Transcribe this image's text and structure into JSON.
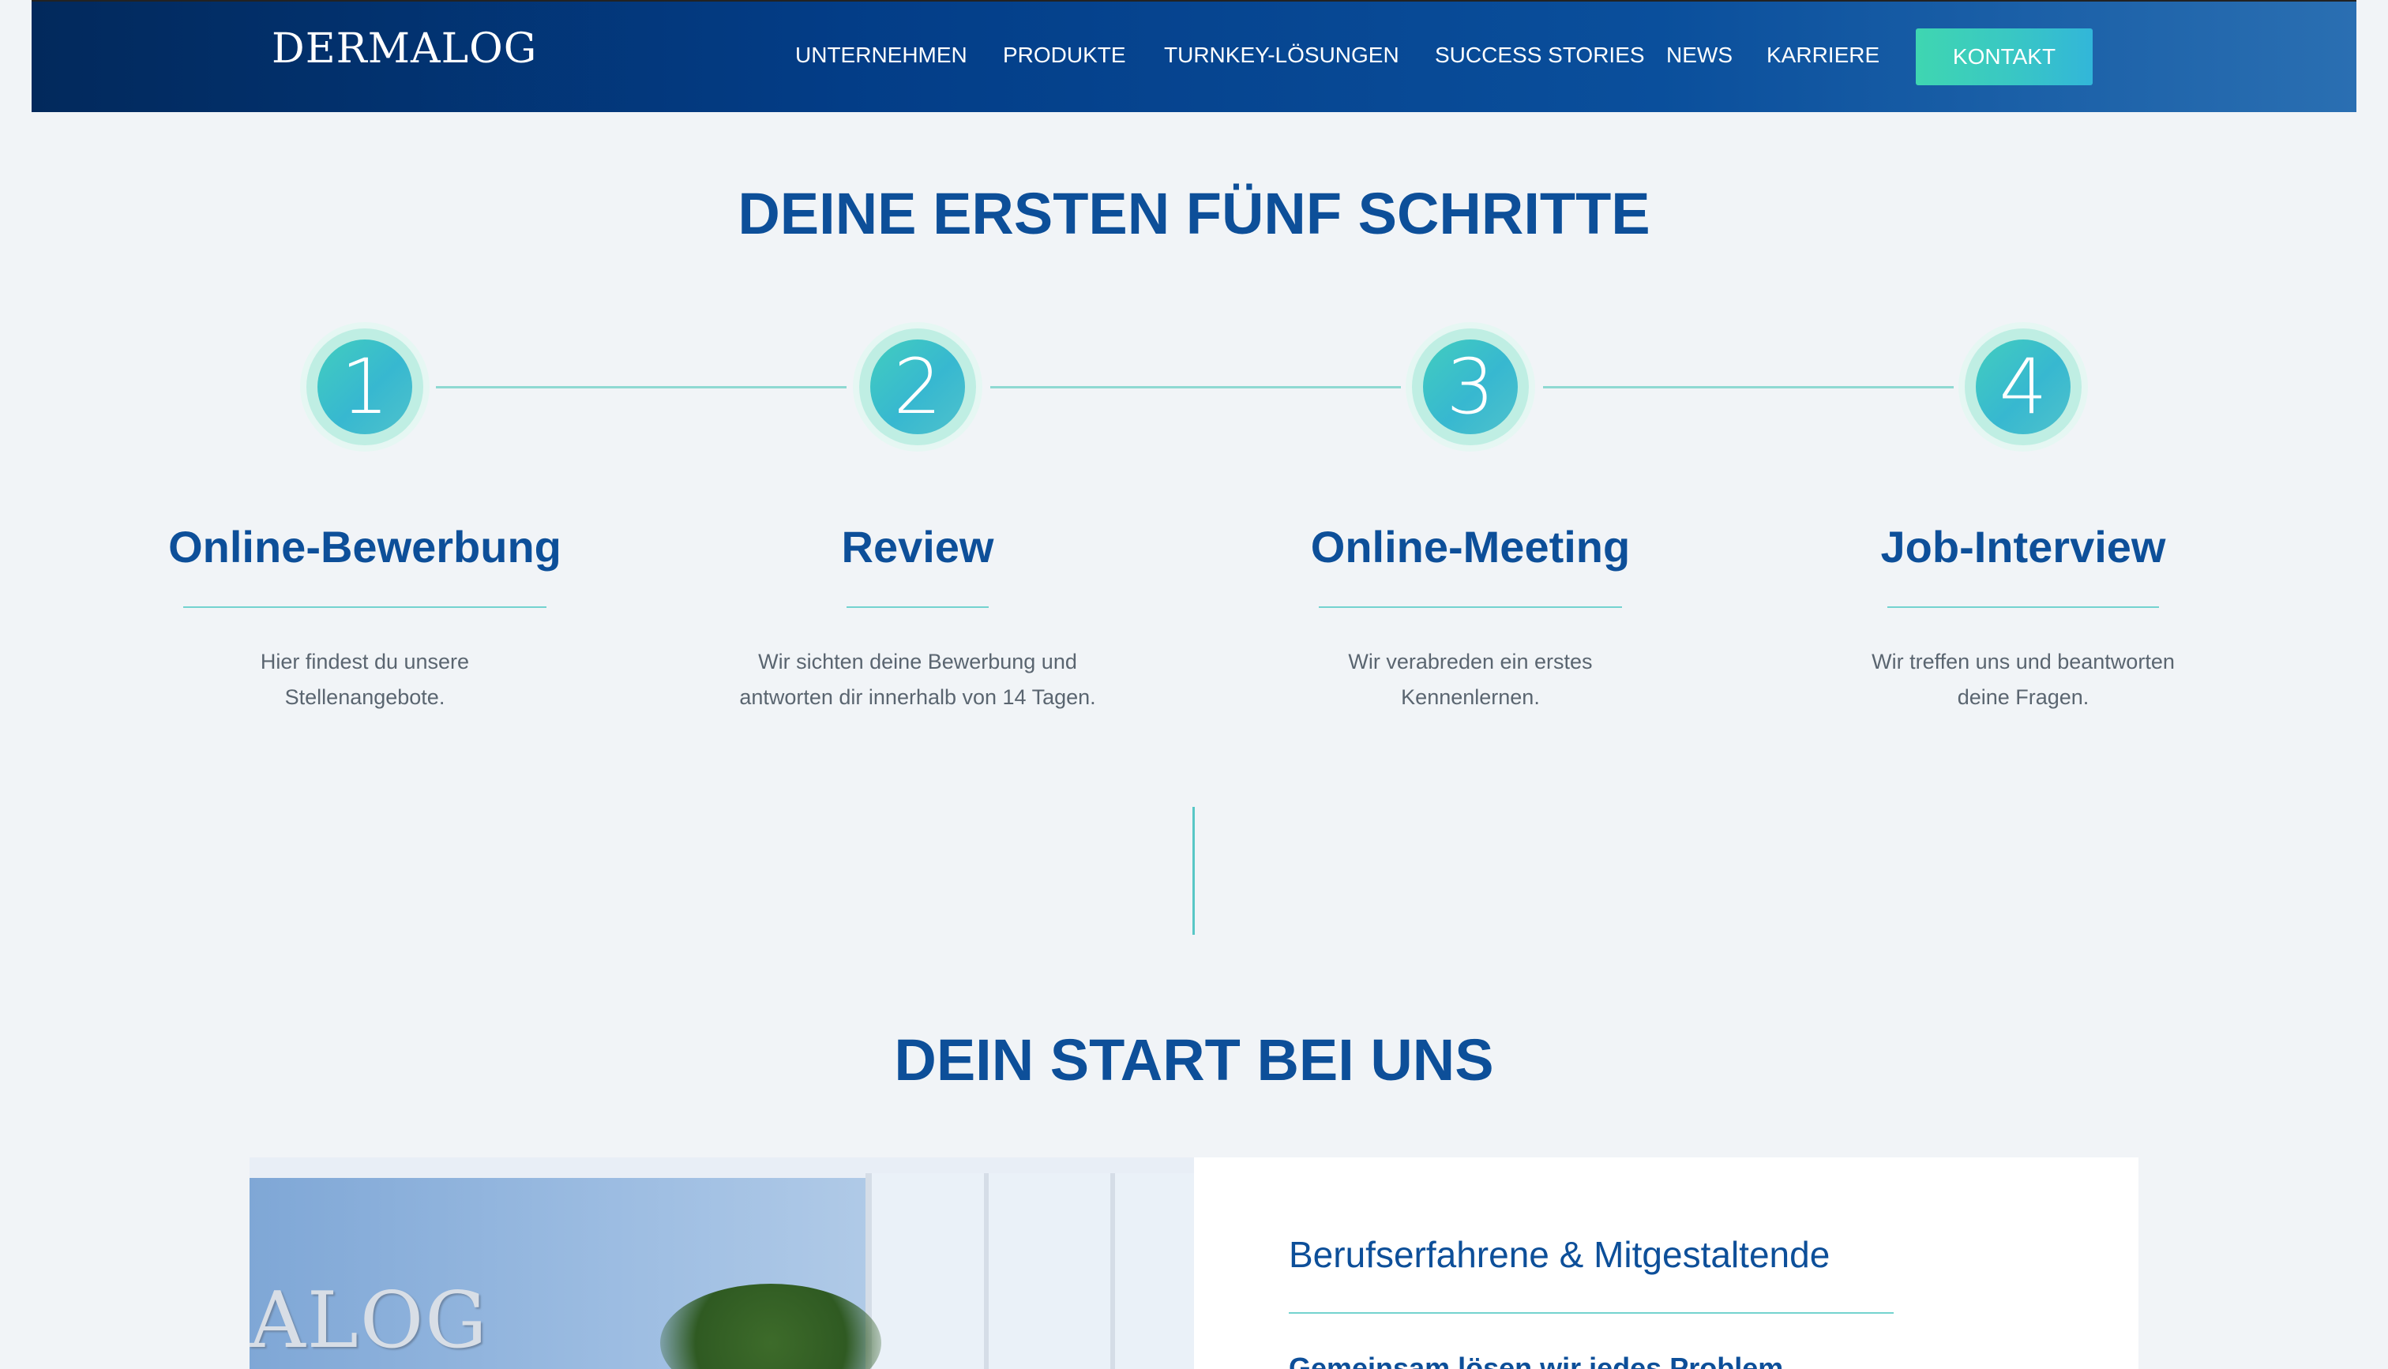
{
  "header": {
    "logo": "DERMALOG",
    "nav": [
      "UNTERNEHMEN",
      "PRODUKTE",
      "TURNKEY-LÖSUNGEN",
      "SUCCESS STORIES",
      "NEWS",
      "KARRIERE"
    ],
    "cta_label": "KONTAKT"
  },
  "steps_section": {
    "title": "DEINE ERSTEN FÜNF SCHRITTE",
    "steps": [
      {
        "number": "1",
        "title": "Online-Bewerbung",
        "desc_line1": "Hier findest du unsere",
        "desc_line2": "Stellenangebote."
      },
      {
        "number": "2",
        "title": "Review",
        "desc_line1": "Wir sichten deine Bewerbung und",
        "desc_line2": "antworten dir innerhalb von 14 Tagen."
      },
      {
        "number": "3",
        "title": "Online-Meeting",
        "desc_line1": "Wir verabreden ein erstes",
        "desc_line2": "Kennenlernen."
      },
      {
        "number": "4",
        "title": "Job-Interview",
        "desc_line1": "Wir treffen uns und beantworten",
        "desc_line2": "deine Fragen."
      }
    ]
  },
  "start_section": {
    "title": "DEIN START BEI UNS",
    "photo_sign": "ALOG",
    "card_heading": "Berufserfahrene & Mitgestaltende",
    "card_sub": "Gemeinsam lösen wir jedes Problem"
  },
  "colors": {
    "primary_blue": "#0d4f99",
    "accent_teal": "#3fd6b1",
    "header_dark": "#02295c"
  }
}
